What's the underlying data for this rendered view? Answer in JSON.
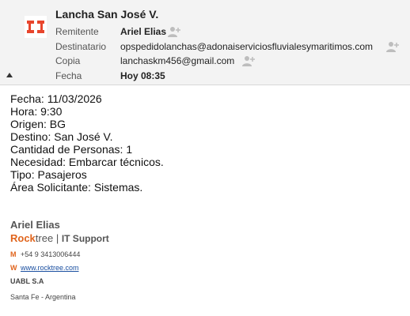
{
  "header": {
    "subject": "Lancha San José V.",
    "logo_icon": "company-logo-icon",
    "fields": [
      {
        "label": "Remitente",
        "value": "Ariel Elias",
        "bold": true
      },
      {
        "label": "Destinatario",
        "value": "opspedidolanchas@adonaiserviciosfluvialesymaritimos.com",
        "bold": false
      },
      {
        "label": "Copia",
        "value": "lanchaskm456@gmail.com",
        "bold": false
      },
      {
        "label": "Fecha",
        "value": "Hoy 08:35",
        "bold": true
      }
    ]
  },
  "body": {
    "lines": [
      "Fecha: 11/03/2026",
      "Hora: 9:30",
      "Origen: BG",
      "Destino: San José V.",
      "Cantidad de Personas: 1",
      "Necesidad: Embarcar técnicos.",
      "Tipo: Pasajeros",
      "Área Solicitante: Sistemas."
    ]
  },
  "signature": {
    "name": "Ariel Elias",
    "brand_rock": "Rock",
    "brand_tree": "tree",
    "separator": " | ",
    "department": "IT Support",
    "mobile_key": "M",
    "mobile": "+54 9 3413006444",
    "web_key": "W",
    "web": "www.rocktree.com",
    "company": "UABL S.A",
    "location": "Santa Fe - Argentina"
  },
  "colors": {
    "accent": "#e0641c",
    "logo": "#e8452c",
    "link": "#1a4fa0"
  }
}
